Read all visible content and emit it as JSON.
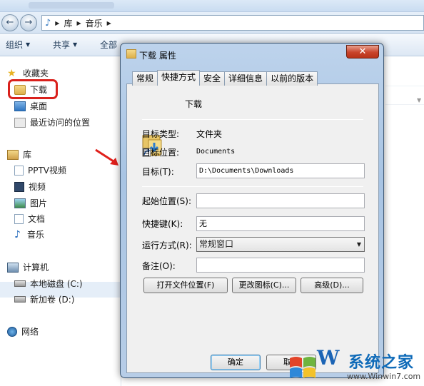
{
  "explorer": {
    "address": {
      "segments": [
        "库",
        "音乐"
      ]
    },
    "toolbar": {
      "organize": "组织",
      "share": "共享",
      "all": "全部"
    },
    "sidebar": {
      "favorites": "收藏夹",
      "downloads": "下载",
      "desktop": "桌面",
      "recent": "最近访问的位置",
      "libraries": "库",
      "pptv": "PPTV视频",
      "videos": "视频",
      "pictures": "图片",
      "documents": "文档",
      "music": "音乐",
      "computer": "计算机",
      "local_disk": "本地磁盘 (C:)",
      "new_volume": "新加卷 (D:)",
      "network": "网络"
    }
  },
  "dialog": {
    "title": "下载 属性",
    "close_label": "✕",
    "tabs": [
      "常规",
      "快捷方式",
      "安全",
      "详细信息",
      "以前的版本"
    ],
    "active_tab": "快捷方式",
    "name": "下载",
    "target_type_label": "目标类型:",
    "target_type_value": "文件夹",
    "target_location_label": "目标位置:",
    "target_location_value": "Documents",
    "target_label": "目标(T):",
    "target_value": "D:\\Documents\\Downloads",
    "start_in_label": "起始位置(S):",
    "start_in_value": "",
    "shortcut_key_label": "快捷键(K):",
    "shortcut_key_value": "无",
    "run_label": "运行方式(R):",
    "run_value": "常规窗口",
    "comment_label": "备注(O):",
    "comment_value": "",
    "open_location_btn": "打开文件位置(F)",
    "change_icon_btn": "更改图标(C)...",
    "advanced_btn": "高级(D)...",
    "ok_btn": "确定",
    "cancel_btn": "取消"
  },
  "watermark": {
    "brand": "系统之家",
    "url": "www.Winwin7.com",
    "letter": "W"
  },
  "colors": {
    "highlight": "#d9211c",
    "arrow": "#e0201b",
    "accent": "#0e6ab8"
  }
}
